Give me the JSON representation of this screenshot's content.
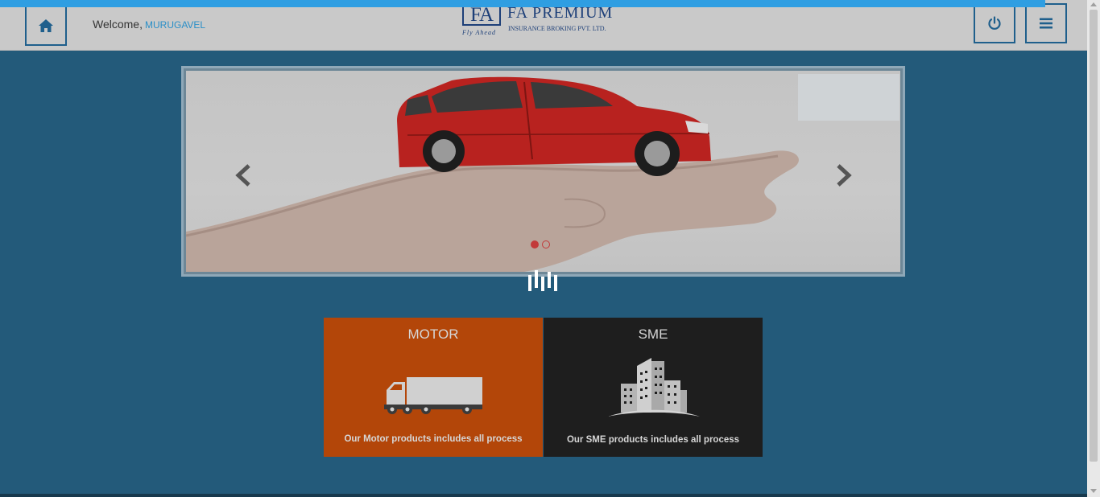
{
  "header": {
    "welcome_label": "Welcome,",
    "username": "MURUGAVEL",
    "logo": {
      "mark": "FA",
      "tagline": "Fly Ahead",
      "brand": "FA PREMIUM",
      "subtitle": "INSURANCE BROKING PVT. LTD."
    },
    "icons": {
      "home": "home-icon",
      "power": "power-icon",
      "menu": "hamburger-menu-icon"
    }
  },
  "carousel": {
    "slide_count": 2,
    "active_slide": 1,
    "slide_image": "red toy car resting on open hand",
    "icons": {
      "prev": "chevron-left-icon",
      "next": "chevron-right-icon"
    }
  },
  "progress": {
    "fraction": 0.95
  },
  "tiles": [
    {
      "title": "MOTOR",
      "description": "Our Motor products includes all process",
      "icon": "truck-icon",
      "color": "#b34609"
    },
    {
      "title": "SME",
      "description": "Our SME products includes all process",
      "icon": "buildings-icon",
      "color": "#1e1e1e"
    }
  ],
  "colors": {
    "background": "#235a7a",
    "accent": "#2f9ee2",
    "brand": "#1d3f78"
  }
}
